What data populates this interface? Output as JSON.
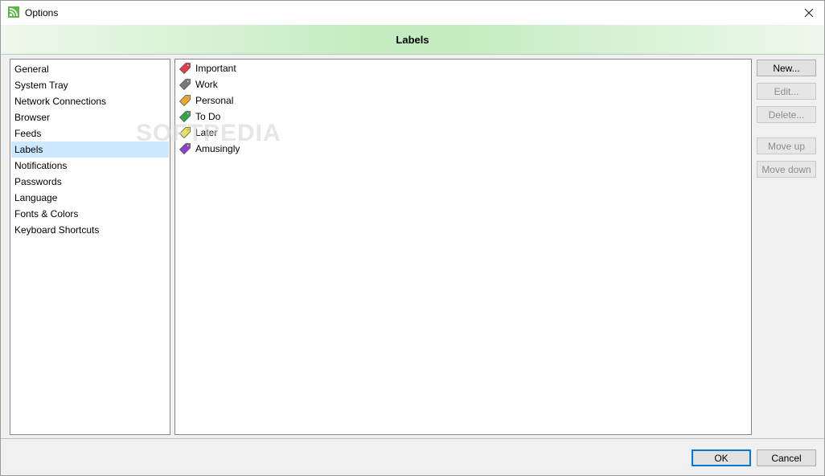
{
  "window": {
    "title": "Options",
    "close_glyph": "✕"
  },
  "header": {
    "title": "Labels"
  },
  "nav": {
    "items": [
      {
        "label": "General"
      },
      {
        "label": "System Tray"
      },
      {
        "label": "Network Connections"
      },
      {
        "label": "Browser"
      },
      {
        "label": "Feeds"
      },
      {
        "label": "Labels",
        "selected": true
      },
      {
        "label": "Notifications"
      },
      {
        "label": "Passwords"
      },
      {
        "label": "Language"
      },
      {
        "label": "Fonts & Colors"
      },
      {
        "label": "Keyboard Shortcuts"
      }
    ]
  },
  "labels": {
    "items": [
      {
        "label": "Important",
        "color": "#e8394a"
      },
      {
        "label": "Work",
        "color": "#7a7a7a"
      },
      {
        "label": "Personal",
        "color": "#f5a623"
      },
      {
        "label": "To Do",
        "color": "#2ea84a"
      },
      {
        "label": "Later",
        "color": "#f2e44a"
      },
      {
        "label": "Amusingly",
        "color": "#8e3fd1"
      }
    ]
  },
  "buttons": {
    "new": "New...",
    "edit": "Edit...",
    "delete": "Delete...",
    "move_up": "Move up",
    "move_down": "Move down",
    "ok": "OK",
    "cancel": "Cancel"
  },
  "watermark": "SOFTPEDIA",
  "colors": {
    "selection": "#cce8ff",
    "header_green": "#c4ecc0",
    "default_button_border": "#0078d7"
  }
}
